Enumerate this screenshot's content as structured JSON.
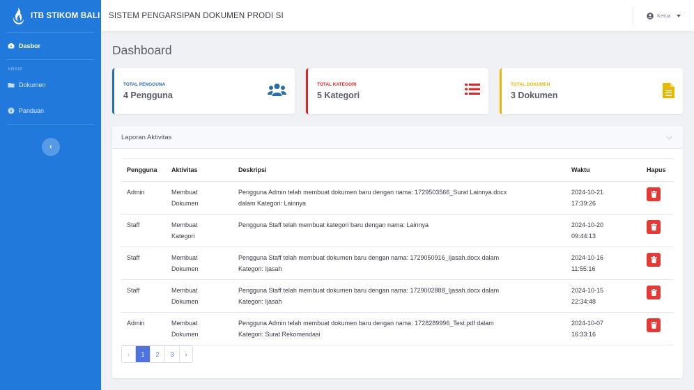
{
  "brand": {
    "name": "ITB STIKOM BALI"
  },
  "sidebar": {
    "dasbor": "Dasbor",
    "heading": "ARSIP",
    "dokumen": "Dokumen",
    "panduan": "Panduan",
    "toggle": "‹"
  },
  "topbar": {
    "title": "SISTEM PENGARSIPAN DOKUMEN PRODI SI",
    "user": "Ketua"
  },
  "page": {
    "title": "Dashboard"
  },
  "cards": [
    {
      "label": "TOTAL PENGGUNA",
      "value": "4 Pengguna",
      "color": "#2b6cb0",
      "icon": "users-icon"
    },
    {
      "label": "TOTAL KATEGORI",
      "value": "5 Kategori",
      "color": "#e02424",
      "icon": "list-icon"
    },
    {
      "label": "TOTAL DOKUMEN",
      "value": "3 Dokumen",
      "color": "#e6b800",
      "icon": "file-icon"
    }
  ],
  "activity": {
    "title": "Laporan Aktivitas",
    "columns": [
      "Pengguna",
      "Aktivitas",
      "Deskripsi",
      "Waktu",
      "Hapus"
    ],
    "rows": [
      {
        "user": "Admin",
        "act1": "Membuat",
        "act2": "Dokumen",
        "desc1": "Pengguna Admin telah membuat dokumen baru dengan nama: 1729503566_Surat Lainnya.docx",
        "desc2": "dalam Kategori: Lainnya",
        "date": "2024-10-21",
        "time": "17:39:26"
      },
      {
        "user": "Staff",
        "act1": "Membuat",
        "act2": "Kategori",
        "desc1": "Pengguna Staff telah membuat kategori baru dengan nama: Lainnya",
        "desc2": "",
        "date": "2024-10-20",
        "time": "09:44:13"
      },
      {
        "user": "Staff",
        "act1": "Membuat",
        "act2": "Dokumen",
        "desc1": "Pengguna Staff telah membuat dokumen baru dengan nama: 1729050916_Ijasah.docx dalam",
        "desc2": "Kategori: Ijasah",
        "date": "2024-10-16",
        "time": "11:55:16"
      },
      {
        "user": "Staff",
        "act1": "Membuat",
        "act2": "Dokumen",
        "desc1": "Pengguna Staff telah membuat dokumen baru dengan nama: 1729002888_Ijasah.docx dalam",
        "desc2": "Kategori: Ijasah",
        "date": "2024-10-15",
        "time": "22:34:48"
      },
      {
        "user": "Admin",
        "act1": "Membuat",
        "act2": "Dokumen",
        "desc1": "Pengguna Admin telah membuat dokumen baru dengan nama: 1728289996_Test.pdf dalam",
        "desc2": "Kategori: Surat Rekomendasi",
        "date": "2024-10-07",
        "time": "16:33:16"
      }
    ]
  },
  "pagination": {
    "prev": "‹",
    "pages": [
      "1",
      "2",
      "3"
    ],
    "next": "›",
    "current": "1"
  }
}
